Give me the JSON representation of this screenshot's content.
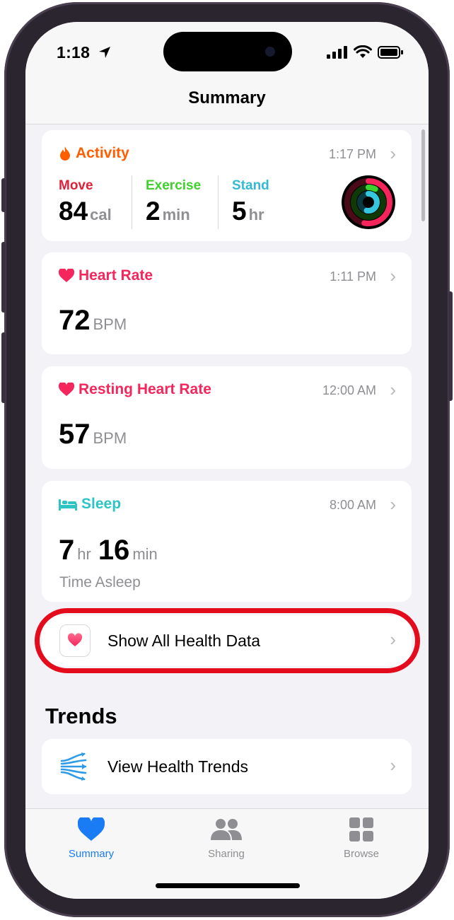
{
  "status_bar": {
    "time": "1:18"
  },
  "nav": {
    "title": "Summary"
  },
  "activity": {
    "title": "Activity",
    "time": "1:17 PM",
    "move": {
      "label": "Move",
      "value": "84",
      "unit": "cal"
    },
    "exercise": {
      "label": "Exercise",
      "value": "2",
      "unit": "min"
    },
    "stand": {
      "label": "Stand",
      "value": "5",
      "unit": "hr"
    },
    "colors": {
      "title": "#ff5e00",
      "move": "#e0203a",
      "exercise": "#3ed12e",
      "stand": "#35b8d6"
    }
  },
  "heart_rate": {
    "title": "Heart Rate",
    "time": "1:11 PM",
    "value": "72",
    "unit": "BPM"
  },
  "resting_heart_rate": {
    "title": "Resting Heart Rate",
    "time": "12:00 AM",
    "value": "57",
    "unit": "BPM"
  },
  "sleep": {
    "title": "Sleep",
    "time": "8:00 AM",
    "hours": "7",
    "hours_unit": "hr",
    "minutes": "16",
    "minutes_unit": "min",
    "caption": "Time Asleep"
  },
  "show_all": {
    "label": "Show All Health Data"
  },
  "trends": {
    "section_title": "Trends",
    "item_label": "View Health Trends"
  },
  "tabbar": {
    "tabs": [
      {
        "label": "Summary",
        "icon": "heart-icon",
        "selected": true
      },
      {
        "label": "Sharing",
        "icon": "people-icon",
        "selected": false
      },
      {
        "label": "Browse",
        "icon": "grid-icon",
        "selected": false
      }
    ]
  },
  "colors": {
    "accent": "#1a7cf5",
    "heart": "#f5265c",
    "highlight": "#e30b1c",
    "sleep": "#2ec4c4"
  }
}
